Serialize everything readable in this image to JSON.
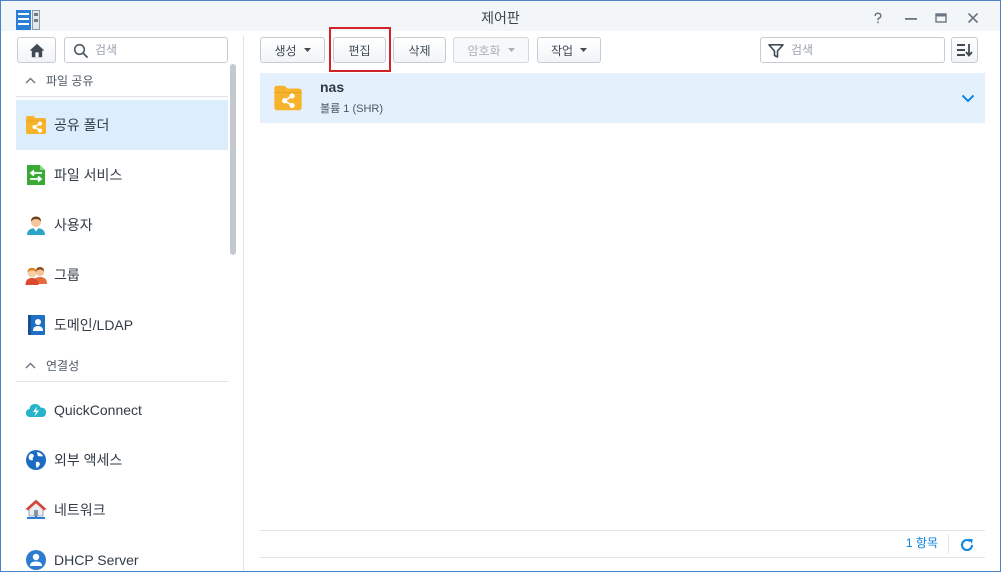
{
  "window": {
    "title": "제어판",
    "app_icon": "control-panel-icon",
    "controls": [
      "help-icon",
      "minimize-icon",
      "maximize-icon",
      "close-icon"
    ]
  },
  "sidebar": {
    "home_icon": "home-icon",
    "search_placeholder": "검색",
    "sections": [
      {
        "label": "파일 공유",
        "expanded": true,
        "items": [
          {
            "label": "공유 폴더",
            "icon": "shared-folder-icon",
            "selected": true
          },
          {
            "label": "파일 서비스",
            "icon": "file-services-icon",
            "selected": false
          },
          {
            "label": "사용자",
            "icon": "user-icon",
            "selected": false
          },
          {
            "label": "그룹",
            "icon": "group-icon",
            "selected": false
          },
          {
            "label": "도메인/LDAP",
            "icon": "domain-ldap-icon",
            "selected": false
          }
        ]
      },
      {
        "label": "연결성",
        "expanded": true,
        "items": [
          {
            "label": "QuickConnect",
            "icon": "quickconnect-icon",
            "selected": false
          },
          {
            "label": "외부 액세스",
            "icon": "external-access-icon",
            "selected": false
          },
          {
            "label": "네트워크",
            "icon": "network-icon",
            "selected": false
          },
          {
            "label": "DHCP Server",
            "icon": "dhcp-server-icon",
            "selected": false
          }
        ]
      }
    ]
  },
  "toolbar": {
    "buttons": [
      {
        "label": "생성",
        "dropdown": true,
        "disabled": false
      },
      {
        "label": "편집",
        "dropdown": false,
        "disabled": false,
        "highlighted": true
      },
      {
        "label": "삭제",
        "dropdown": false,
        "disabled": false
      },
      {
        "label": "암호화",
        "dropdown": true,
        "disabled": true
      },
      {
        "label": "작업",
        "dropdown": true,
        "disabled": false
      }
    ],
    "search_placeholder": "검색",
    "filter_icon": "filter-icon",
    "sort_icon": "sort-icon"
  },
  "shared_folders": {
    "items": [
      {
        "name": "nas",
        "location": "볼륨 1 (SHR)",
        "icon": "shared-folder-icon",
        "selected": true
      }
    ]
  },
  "footer": {
    "count": "1 항목",
    "refresh_icon": "refresh-icon"
  },
  "colors": {
    "accent": "#0a80d8",
    "selected_bg": "#dcedfb",
    "row_selected_bg": "#e4f1fc",
    "highlight_border": "#d2232a",
    "window_border": "#4b84c4",
    "folder_yellow": "#f7b32b"
  }
}
